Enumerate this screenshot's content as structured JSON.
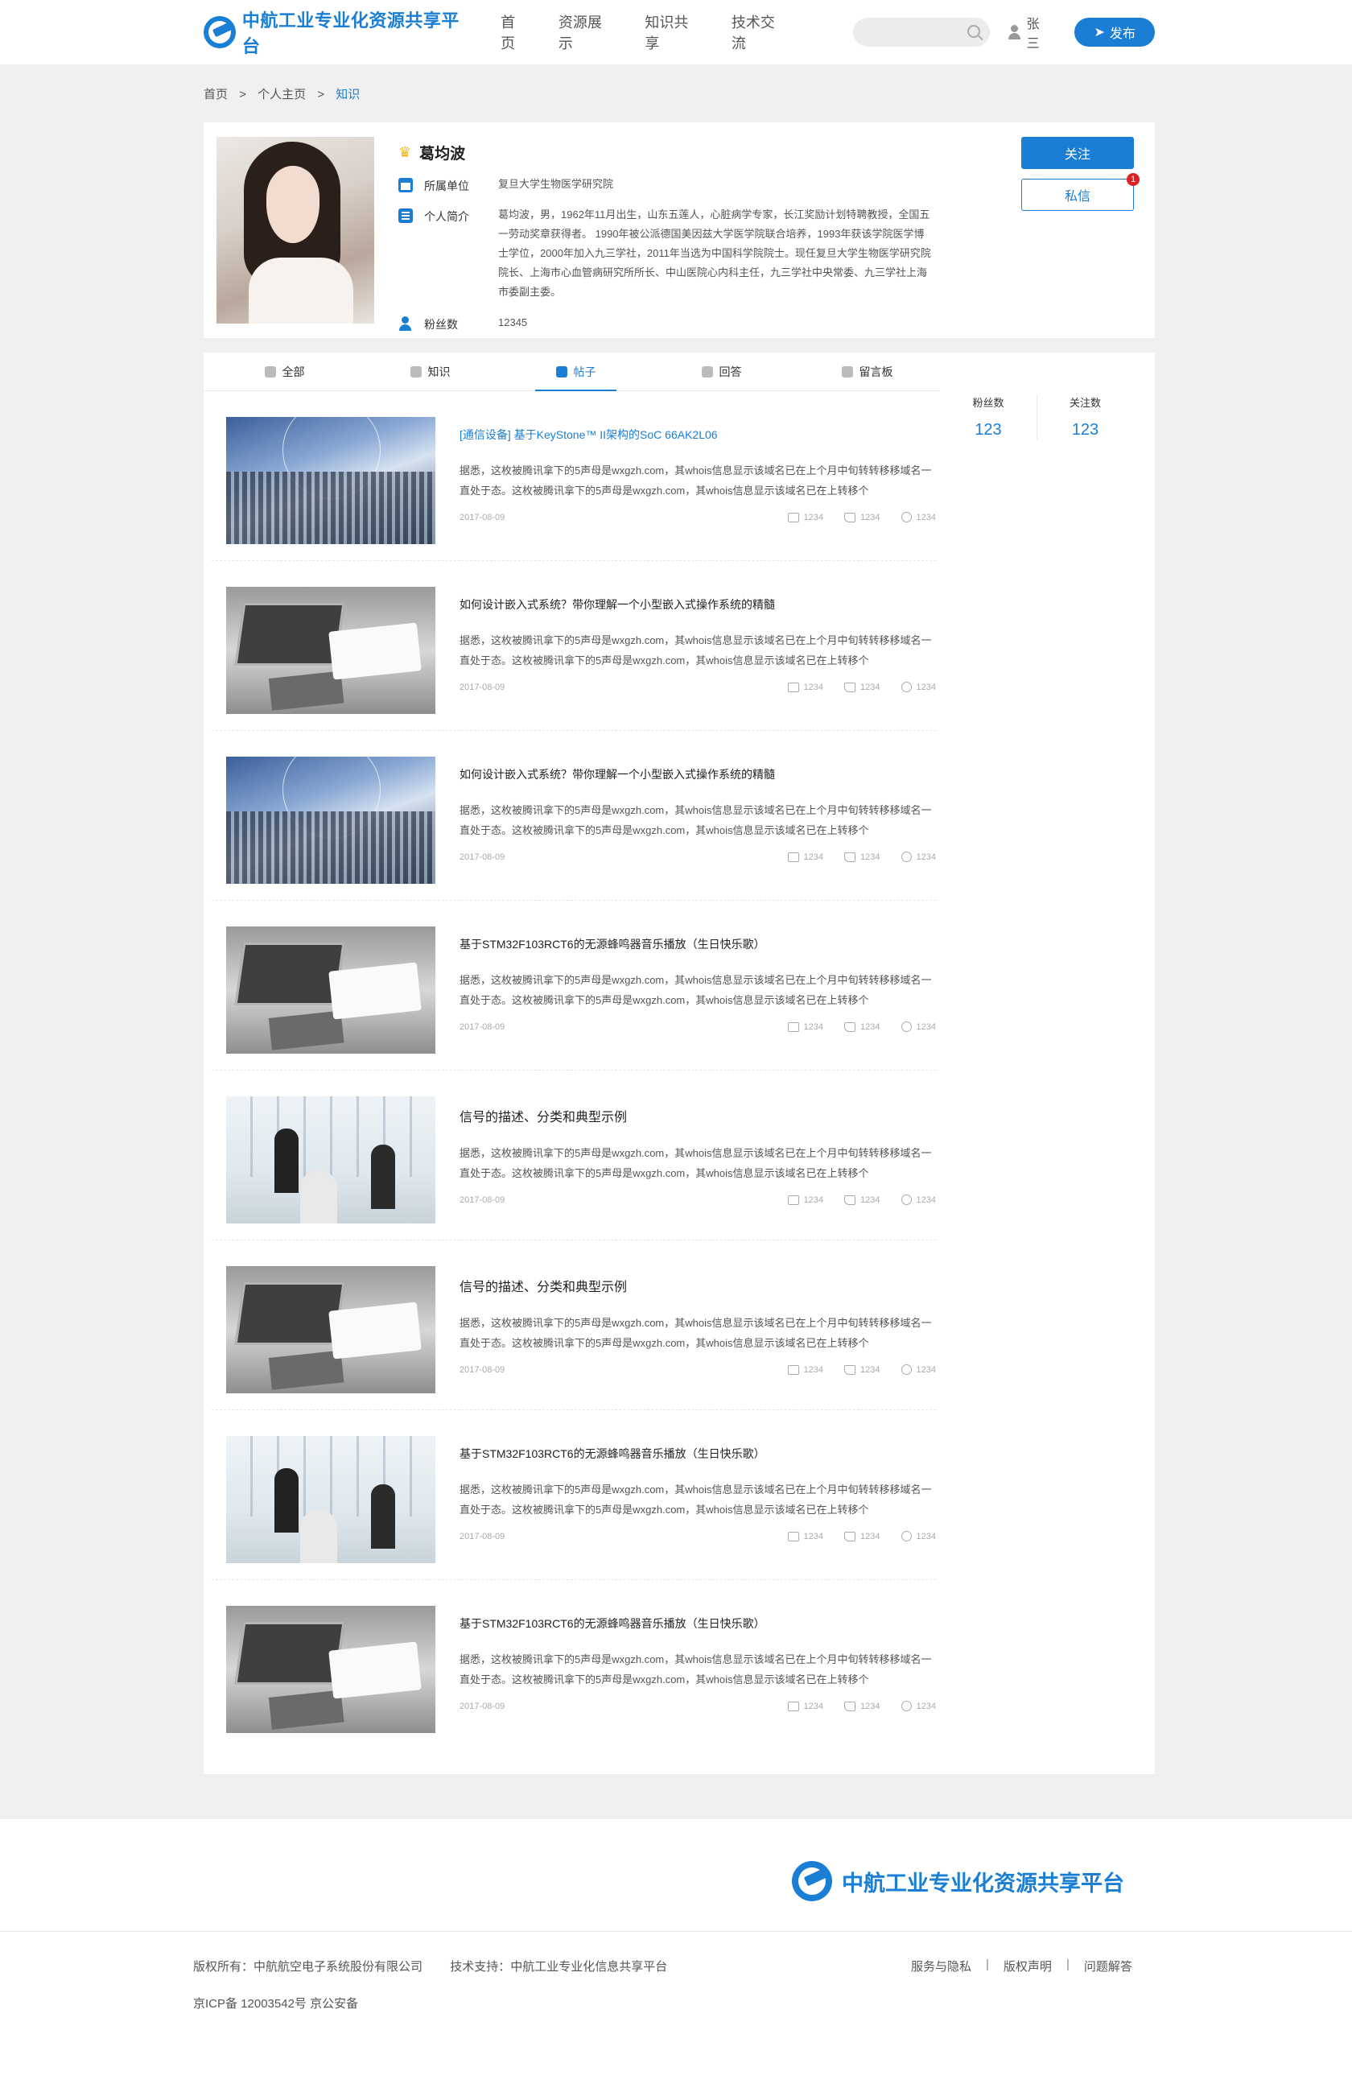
{
  "header": {
    "logo_text": "中航工业专业化资源共享平台",
    "nav": [
      "首页",
      "资源展示",
      "知识共享",
      "技术交流"
    ],
    "search_placeholder": "",
    "user_name": "张三",
    "publish_label": "发布"
  },
  "breadcrumb": {
    "items": [
      "首页",
      "个人主页",
      "知识"
    ],
    "sep": ">"
  },
  "profile": {
    "name": "葛均波",
    "org_label": "所属单位",
    "org": "复旦大学生物医学研究院",
    "intro_label": "个人简介",
    "intro": "葛均波，男，1962年11月出生，山东五莲人，心脏病学专家，长江奖励计划特聘教授，全国五一劳动奖章获得者。 1990年被公派德国美因兹大学医学院联合培养，1993年获该学院医学博士学位，2000年加入九三学社，2011年当选为中国科学院院士。现任复旦大学生物医学研究院院长、上海市心血管病研究所所长、中山医院心内科主任，九三学社中央常委、九三学社上海市委副主委。",
    "fans_label": "粉丝数",
    "fans": "12345",
    "follow_label": "关注",
    "message_label": "私信",
    "message_badge": "1"
  },
  "tabs": [
    {
      "label": "全部",
      "icon": "grid-icon"
    },
    {
      "label": "知识",
      "icon": "book-icon"
    },
    {
      "label": "帖子",
      "icon": "post-icon"
    },
    {
      "label": "回答",
      "icon": "comment-icon"
    },
    {
      "label": "留言板",
      "icon": "message-board-icon"
    }
  ],
  "counts": {
    "fans_label": "粉丝数",
    "fans_value": "123",
    "follow_label": "关注数",
    "follow_value": "123"
  },
  "posts": [
    {
      "title": "[通信设备] 基于KeyStone™ II架构的SoC 66AK2L06",
      "desc": "据悉，这枚被腾讯拿下的5声母是wxgzh.com，其whois信息显示该域名已在上个月中旬转转移移域名一直处于态。这枚被腾讯拿下的5声母是wxgzh.com，其whois信息显示该域名已在上转移个",
      "date": "2017-08-09",
      "comments": "1234",
      "likes": "1234",
      "favs": "1234"
    },
    {
      "title": "如何设计嵌入式系统？带你理解一个小型嵌入式操作系统的精髓",
      "desc": "据悉，这枚被腾讯拿下的5声母是wxgzh.com，其whois信息显示该域名已在上个月中旬转转移移域名一直处于态。这枚被腾讯拿下的5声母是wxgzh.com，其whois信息显示该域名已在上转移个",
      "date": "2017-08-09",
      "comments": "1234",
      "likes": "1234",
      "favs": "1234"
    },
    {
      "title": "如何设计嵌入式系统？带你理解一个小型嵌入式操作系统的精髓",
      "desc": "据悉，这枚被腾讯拿下的5声母是wxgzh.com，其whois信息显示该域名已在上个月中旬转转移移域名一直处于态。这枚被腾讯拿下的5声母是wxgzh.com，其whois信息显示该域名已在上转移个",
      "date": "2017-08-09",
      "comments": "1234",
      "likes": "1234",
      "favs": "1234"
    },
    {
      "title": "基于STM32F103RCT6的无源蜂鸣器音乐播放（生日快乐歌）",
      "desc": "据悉，这枚被腾讯拿下的5声母是wxgzh.com，其whois信息显示该域名已在上个月中旬转转移移域名一直处于态。这枚被腾讯拿下的5声母是wxgzh.com，其whois信息显示该域名已在上转移个",
      "date": "2017-08-09",
      "comments": "1234",
      "likes": "1234",
      "favs": "1234"
    },
    {
      "title": "信号的描述、分类和典型示例",
      "desc": "据悉，这枚被腾讯拿下的5声母是wxgzh.com，其whois信息显示该域名已在上个月中旬转转移移域名一直处于态。这枚被腾讯拿下的5声母是wxgzh.com，其whois信息显示该域名已在上转移个",
      "date": "2017-08-09",
      "comments": "1234",
      "likes": "1234",
      "favs": "1234"
    },
    {
      "title": "信号的描述、分类和典型示例",
      "desc": "据悉，这枚被腾讯拿下的5声母是wxgzh.com，其whois信息显示该域名已在上个月中旬转转移移域名一直处于态。这枚被腾讯拿下的5声母是wxgzh.com，其whois信息显示该域名已在上转移个",
      "date": "2017-08-09",
      "comments": "1234",
      "likes": "1234",
      "favs": "1234"
    },
    {
      "title": "基于STM32F103RCT6的无源蜂鸣器音乐播放（生日快乐歌）",
      "desc": "据悉，这枚被腾讯拿下的5声母是wxgzh.com，其whois信息显示该域名已在上个月中旬转转移移域名一直处于态。这枚被腾讯拿下的5声母是wxgzh.com，其whois信息显示该域名已在上转移个",
      "date": "2017-08-09",
      "comments": "1234",
      "likes": "1234",
      "favs": "1234"
    },
    {
      "title": "基于STM32F103RCT6的无源蜂鸣器音乐播放（生日快乐歌）",
      "desc": "据悉，这枚被腾讯拿下的5声母是wxgzh.com，其whois信息显示该域名已在上个月中旬转转移移域名一直处于态。这枚被腾讯拿下的5声母是wxgzh.com，其whois信息显示该域名已在上转移个",
      "date": "2017-08-09",
      "comments": "1234",
      "likes": "1234",
      "favs": "1234"
    }
  ],
  "footer": {
    "logo_text": "中航工业专业化资源共享平台",
    "copyright": "版权所有：中航航空电子系统股份有限公司",
    "tech_support": "技术支持：中航工业专业化信息共享平台",
    "icp": "京ICP备 12003542号 京公安备",
    "links": [
      "服务与隐私",
      "版权声明",
      "问题解答"
    ],
    "link_sep": "|"
  },
  "colors": {
    "accent": "#1a7fd4",
    "badge": "#e02020",
    "page_bg": "#f0f0f0"
  }
}
